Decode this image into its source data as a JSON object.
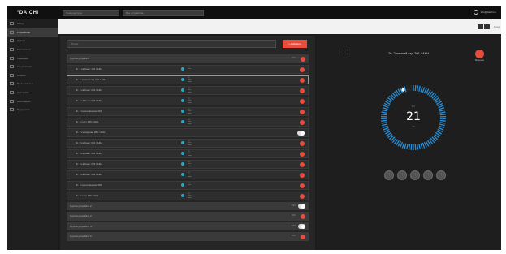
{
  "topbar": {
    "logo": "°DAICHI",
    "field1": "Точка доступа",
    "field2": "Все устройства",
    "user": "info@daichi.ru"
  },
  "sidebar": {
    "items": [
      {
        "label": "Обзор",
        "active": false
      },
      {
        "label": "Устройства",
        "active": true
      },
      {
        "label": "Здания",
        "active": false
      },
      {
        "label": "Расписания",
        "active": false
      },
      {
        "label": "Сценарии",
        "active": false
      },
      {
        "label": "Уведомления",
        "active": false
      },
      {
        "label": "Отчеты",
        "active": false
      },
      {
        "label": "Пользователи",
        "active": false
      },
      {
        "label": "Настройки",
        "active": false
      },
      {
        "label": "Интеграции",
        "active": false
      },
      {
        "label": "Поддержка",
        "active": false
      }
    ]
  },
  "content_top": {
    "right_text": "Вход"
  },
  "leftpanel": {
    "search_placeholder": "Поиск",
    "add_label": "+ Добавить",
    "group1": {
      "label": "Группа устройств",
      "tag": "ВКЛ"
    },
    "rows": [
      {
        "label": "Эт. 1 кабинет 101 / АКН",
        "info": [
          "23°",
          "Охл.",
          "Авто"
        ],
        "end": "dot",
        "hl": false
      },
      {
        "label": "Эт. 2 зимний сад 201 / АКН",
        "info": [
          "21°",
          "Охл.",
          "Авто"
        ],
        "end": "dot",
        "hl": true
      },
      {
        "label": "Эт. 2 кабинет 202 / АКН",
        "info": [
          "22°",
          "Охл.",
          "Авто"
        ],
        "end": "dot",
        "hl": false
      },
      {
        "label": "Эт. 2 кабинет 203 / АКН",
        "info": [
          "22°",
          "Охл.",
          "Авто"
        ],
        "end": "dot",
        "hl": false
      },
      {
        "label": "Эт. 2 переговорная 204",
        "info": [
          "24°",
          "Охл.",
          "Авто"
        ],
        "end": "dot",
        "hl": false
      },
      {
        "label": "Эт. 2 холл 205 / АКН",
        "info": [
          "23°",
          "Охл.",
          "Авто"
        ],
        "end": "dot",
        "hl": false
      },
      {
        "label": "Эт. 2 серверная 206 / АКН",
        "info": [],
        "end": "toggle",
        "hl": false
      },
      {
        "label": "Эт. 3 кабинет 301 / АКН",
        "info": [
          "22°",
          "Охл.",
          "Авто"
        ],
        "end": "dot",
        "hl": false
      },
      {
        "label": "Эт. 3 кабинет 302 / АКН",
        "info": [
          "21°",
          "Охл.",
          "Авто"
        ],
        "end": "dot",
        "hl": false
      },
      {
        "label": "Эт. 3 кабинет 303 / АКН",
        "info": [
          "23°",
          "Охл.",
          "Авто"
        ],
        "end": "dot",
        "hl": false
      },
      {
        "label": "Эт. 3 кабинет 304 / АКН",
        "info": [
          "22°",
          "Охл.",
          "Авто"
        ],
        "end": "dot",
        "hl": false
      },
      {
        "label": "Эт. 3 переговорная 305",
        "info": [
          "24°",
          "Охл.",
          "Авто"
        ],
        "end": "dot",
        "hl": false
      },
      {
        "label": "Эт. 3 холл 306 / АКН",
        "info": [
          "23°",
          "Охл.",
          "Авто"
        ],
        "end": "dot",
        "hl": false
      }
    ],
    "groups_bottom": [
      {
        "label": "Группа устройств 2",
        "tag": "ВКЛ",
        "end": "toggle"
      },
      {
        "label": "Группа устройств 3",
        "tag": "ВКЛ",
        "end": "dot"
      },
      {
        "label": "Группа устройств 4",
        "tag": "ВКЛ",
        "end": "toggle"
      },
      {
        "label": "Группа устройств 5",
        "tag": "ВКЛ",
        "end": "dot"
      }
    ]
  },
  "rightpanel": {
    "title": "Эт. 2 зимний сад 201 / АКН",
    "power_label": "Включено",
    "dial_label": "Уст.",
    "temperature": "21",
    "unit": "°C",
    "dial_fill": 0.97,
    "mode_icons": [
      "mode-cool-icon",
      "mode-heat-icon",
      "mode-fan-icon",
      "mode-dry-icon",
      "mode-auto-icon"
    ]
  },
  "colors": {
    "accent": "#e84c3d",
    "dial": "#2a8fd6",
    "info_dot": "#27a7c6"
  }
}
